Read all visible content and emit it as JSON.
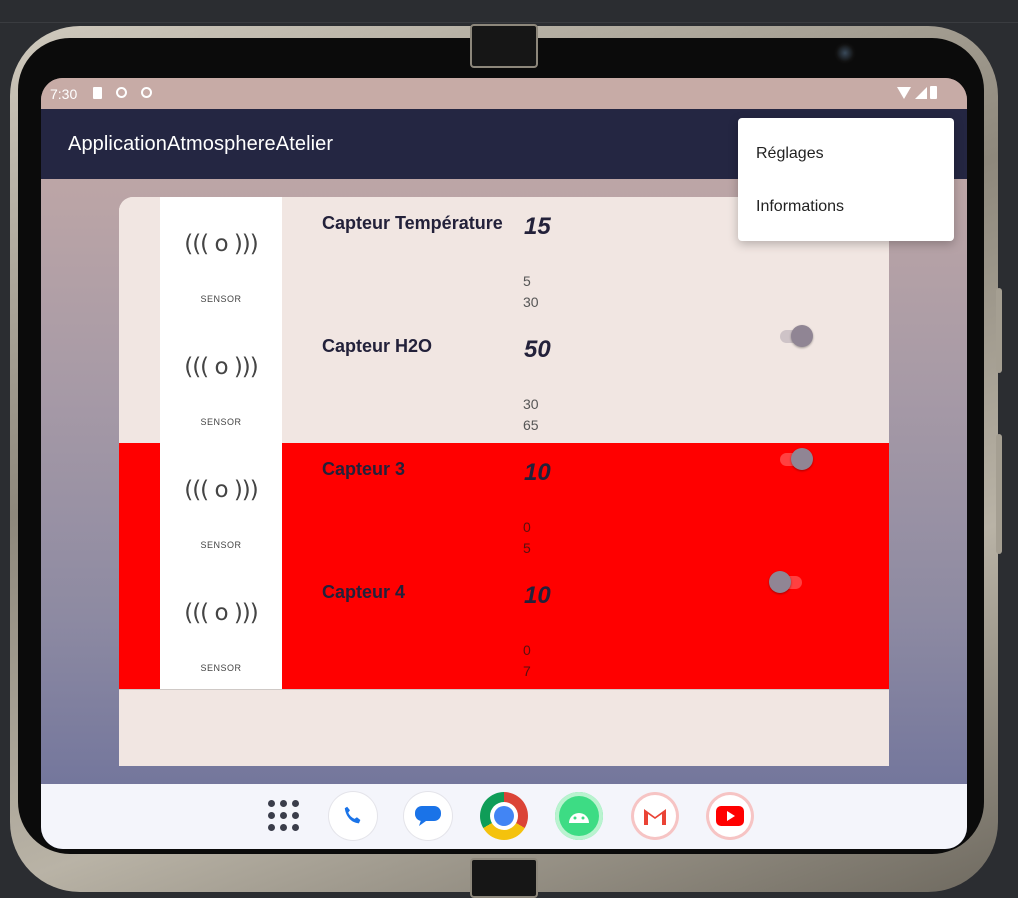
{
  "status_bar": {
    "time": "7:30"
  },
  "app_bar": {
    "title": "ApplicationAtmosphereAtelier"
  },
  "overflow_menu": {
    "items": [
      {
        "label": "Réglages"
      },
      {
        "label": "Informations"
      }
    ]
  },
  "sensors": [
    {
      "name": "Capteur Température",
      "value": "15",
      "min": "5",
      "max": "30",
      "image_caption": "SENSOR",
      "alert": false,
      "switch_on": null
    },
    {
      "name": "Capteur H2O",
      "value": "50",
      "min": "30",
      "max": "65",
      "image_caption": "SENSOR",
      "alert": false,
      "switch_on": true
    },
    {
      "name": "Capteur 3",
      "value": "10",
      "min": "0",
      "max": "5",
      "image_caption": "SENSOR",
      "alert": true,
      "switch_on": true
    },
    {
      "name": "Capteur 4",
      "value": "10",
      "min": "0",
      "max": "7",
      "image_caption": "SENSOR",
      "alert": true,
      "switch_on": false
    }
  ],
  "sensor_icon_glyph": "((( o )))",
  "colors": {
    "app_bar": "#242642",
    "alert_row": "#ff0000",
    "normal_row": "#f1e6e2"
  },
  "dock": {
    "apps": [
      {
        "icon": "phone-icon"
      },
      {
        "icon": "messages-icon"
      },
      {
        "icon": "chrome-icon"
      },
      {
        "icon": "android-studio-icon"
      },
      {
        "icon": "gmail-icon"
      },
      {
        "icon": "youtube-icon"
      }
    ]
  }
}
